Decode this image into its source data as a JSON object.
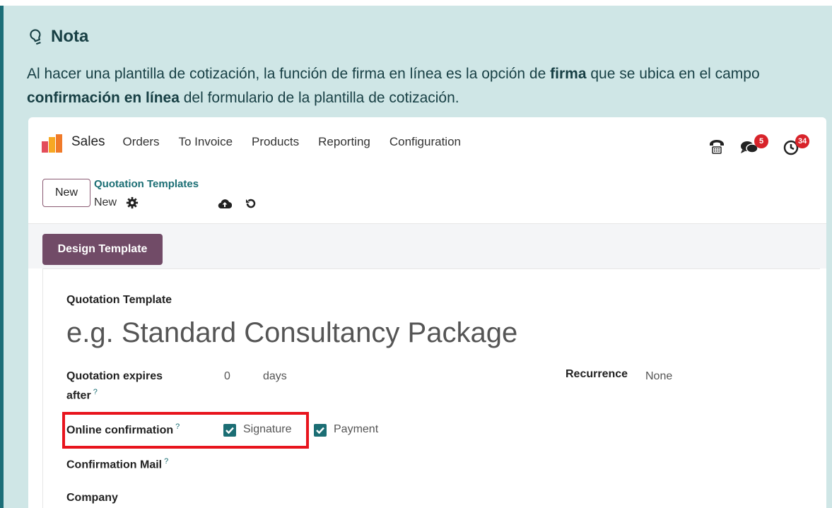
{
  "note": {
    "title": "Nota",
    "body_1": "Al hacer una plantilla de cotización, la función de firma en línea es la opción de ",
    "body_bold_1": "firma",
    "body_2": " que se ubica en el campo ",
    "body_bold_2": "confirmación en línea",
    "body_3": " del formulario de la plantilla de cotización."
  },
  "navbar": {
    "app_name": "Sales",
    "menu": [
      "Orders",
      "To Invoice",
      "Products",
      "Reporting",
      "Configuration"
    ],
    "messages_badge": "5",
    "activities_badge": "34"
  },
  "control_panel": {
    "new_button": "New",
    "breadcrumb_parent": "Quotation Templates",
    "breadcrumb_current": "New"
  },
  "status_bar": {
    "design_button": "Design Template"
  },
  "form": {
    "name_label": "Quotation Template",
    "name_placeholder": "e.g. Standard Consultancy Package",
    "expires_label_1": "Quotation expires",
    "expires_label_2": "after",
    "expires_value": "0",
    "expires_unit": "days",
    "recurrence_label": "Recurrence",
    "recurrence_value": "None",
    "online_confirmation_label": "Online confirmation",
    "signature_label": "Signature",
    "signature_checked": true,
    "payment_label": "Payment",
    "payment_checked": true,
    "confirmation_mail_label": "Confirmation Mail",
    "company_label": "Company",
    "tooltip_mark": "?"
  },
  "colors": {
    "note_bg": "#cfe6e6",
    "note_border": "#1c6e78",
    "brand_primary": "#714b67",
    "link_teal": "#1b6e74",
    "highlight_red": "#e8141d",
    "badge_red": "#d8232a"
  },
  "icons": [
    "lightbulb-icon",
    "sales-logo-icon",
    "phone-icon",
    "chat-icon",
    "clock-icon",
    "gear-icon",
    "cloud-upload-icon",
    "undo-icon",
    "checkbox-check-icon"
  ]
}
